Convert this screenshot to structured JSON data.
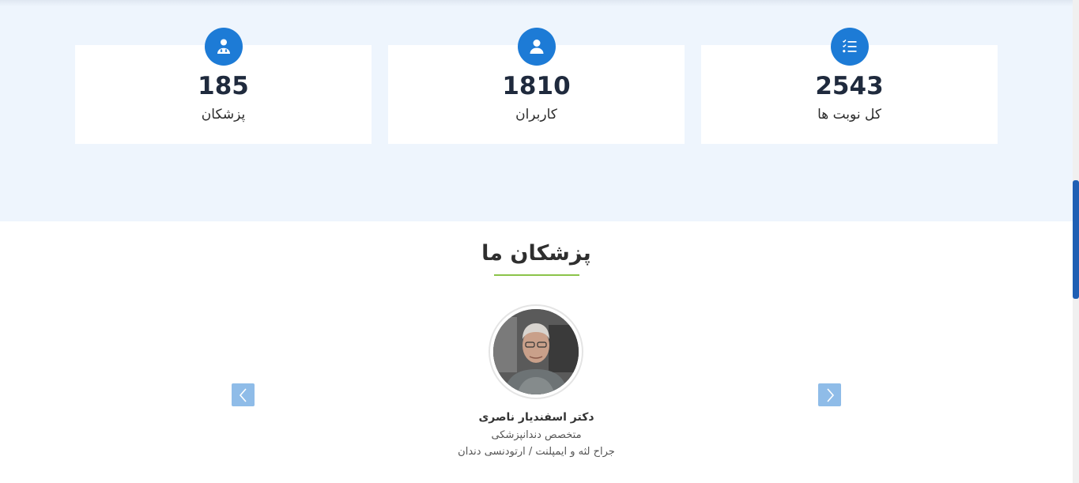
{
  "stats": [
    {
      "value": "2543",
      "label": "کل نوبت ها",
      "icon": "task-list-icon"
    },
    {
      "value": "1810",
      "label": "کاربران",
      "icon": "user-icon"
    },
    {
      "value": "185",
      "label": "پزشکان",
      "icon": "doctor-icon"
    }
  ],
  "doctors_section": {
    "title": "پزشکان ما",
    "doctor": {
      "name": "دکتر اسفندیار ناصری",
      "specialty": "متخصص دندانپزشکی",
      "subspecialty": "جراح لثه و ایمپلنت / ارتودنسی دندان"
    }
  },
  "colors": {
    "accent": "#1d7bd6",
    "stats_background": "#eef5fd",
    "title_underline": "#8bc34a",
    "arrow_button": "#8fbce8"
  }
}
